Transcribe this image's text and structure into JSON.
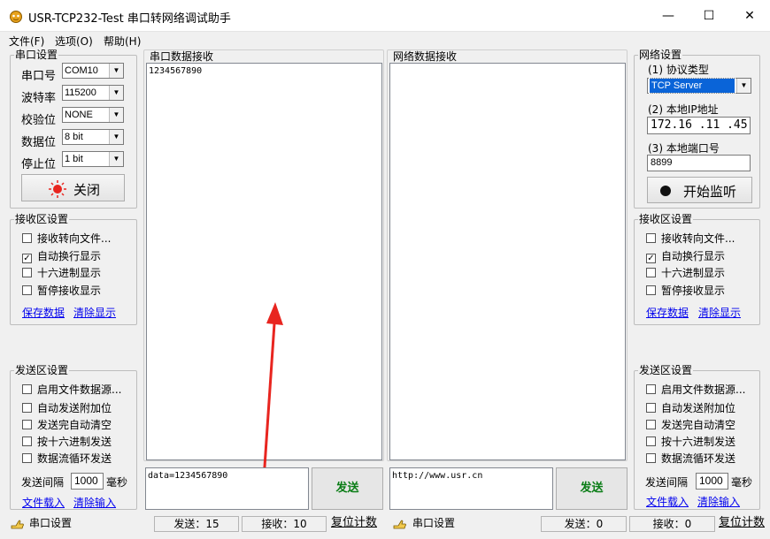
{
  "window": {
    "title": "USR-TCP232-Test 串口转网络调试助手",
    "minimize": "—",
    "maximize": "☐",
    "close": "✕"
  },
  "menu": [
    "文件(F)",
    "选项(O)",
    "帮助(H)"
  ],
  "serial_settings": {
    "legend": "串口设置",
    "fields": [
      {
        "label": "串口号",
        "value": "COM10"
      },
      {
        "label": "波特率",
        "value": "115200"
      },
      {
        "label": "校验位",
        "value": "NONE"
      },
      {
        "label": "数据位",
        "value": "8 bit"
      },
      {
        "label": "停止位",
        "value": "1 bit"
      }
    ],
    "close_button": "关闭"
  },
  "left_receive": {
    "legend": "接收区设置",
    "options": [
      {
        "label": "接收转向文件...",
        "checked": false
      },
      {
        "label": "自动换行显示",
        "checked": true
      },
      {
        "label": "十六进制显示",
        "checked": false
      },
      {
        "label": "暂停接收显示",
        "checked": false
      }
    ],
    "save_link": "保存数据",
    "clear_link": "清除显示"
  },
  "left_send": {
    "legend": "发送区设置",
    "options": [
      {
        "label": "启用文件数据源...",
        "checked": false
      },
      {
        "label": "自动发送附加位",
        "checked": false
      },
      {
        "label": "发送完自动清空",
        "checked": false
      },
      {
        "label": "按十六进制发送",
        "checked": false
      },
      {
        "label": "数据流循环发送",
        "checked": false
      }
    ],
    "interval_label": "发送间隔",
    "interval_value": "1000",
    "interval_unit": "毫秒",
    "load_link": "文件载入",
    "clear_link": "清除输入"
  },
  "serial_receive": {
    "header": "串口数据接收",
    "content": "1234567890"
  },
  "network_receive": {
    "header": "网络数据接收",
    "content": ""
  },
  "serial_send": {
    "content": "data=1234567890",
    "button": "发送"
  },
  "network_send": {
    "content": "http://www.usr.cn",
    "button": "发送"
  },
  "network_settings": {
    "legend": "网络设置",
    "protocol_label": "(1) 协议类型",
    "protocol_value": "TCP Server",
    "ip_label": "(2) 本地IP地址",
    "ip_value": "172.16 .11 .45",
    "port_label": "(3) 本地端口号",
    "port_value": "8899",
    "listen_button": "开始监听"
  },
  "right_receive": {
    "legend": "接收区设置",
    "options": [
      {
        "label": "接收转向文件...",
        "checked": false
      },
      {
        "label": "自动换行显示",
        "checked": true
      },
      {
        "label": "十六进制显示",
        "checked": false
      },
      {
        "label": "暂停接收显示",
        "checked": false
      }
    ],
    "save_link": "保存数据",
    "clear_link": "清除显示"
  },
  "right_send": {
    "legend": "发送区设置",
    "options": [
      {
        "label": "启用文件数据源...",
        "checked": false
      },
      {
        "label": "自动发送附加位",
        "checked": false
      },
      {
        "label": "发送完自动清空",
        "checked": false
      },
      {
        "label": "按十六进制发送",
        "checked": false
      },
      {
        "label": "数据流循环发送",
        "checked": false
      }
    ],
    "interval_label": "发送间隔",
    "interval_value": "1000",
    "interval_unit": "毫秒",
    "load_link": "文件载入",
    "clear_link": "清除输入"
  },
  "status_left": {
    "label": "串口设置",
    "sent": "发送：15",
    "received": "接收：10",
    "reset": "复位计数"
  },
  "status_right": {
    "label": "串口设置",
    "sent": "发送：0",
    "received": "接收：0",
    "reset": "复位计数"
  },
  "colors": {
    "accent_arrow": "#e8251f",
    "send_text": "#0a7d16",
    "link": "#0000ee",
    "combo_selected": "#0a64d8"
  }
}
